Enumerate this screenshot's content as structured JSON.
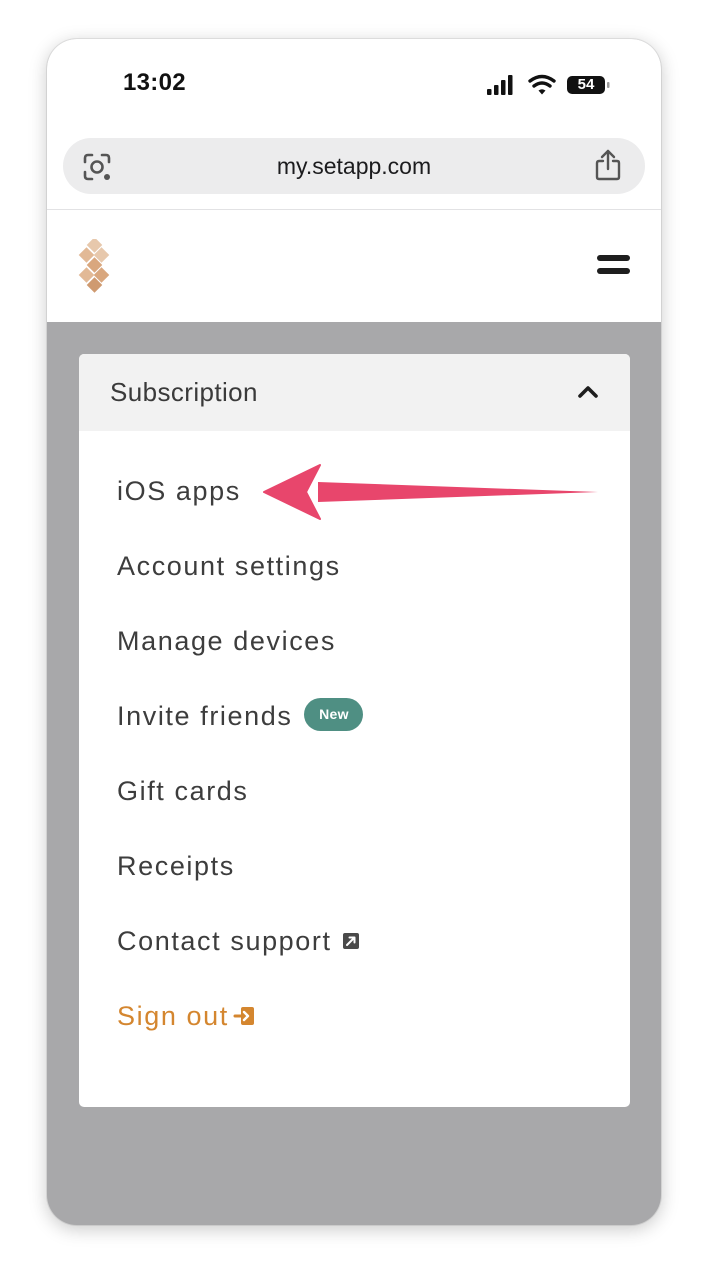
{
  "status_bar": {
    "time": "13:02",
    "battery": "54"
  },
  "browser": {
    "url": "my.setapp.com"
  },
  "menu": {
    "section_title": "Subscription",
    "items": [
      {
        "label": "iOS apps"
      },
      {
        "label": "Account settings"
      },
      {
        "label": "Manage devices"
      },
      {
        "label": "Invite friends",
        "badge": "New"
      },
      {
        "label": "Gift cards"
      },
      {
        "label": "Receipts"
      },
      {
        "label": "Contact support",
        "icon": "external-link-icon"
      },
      {
        "label": "Sign out",
        "icon": "sign-out-icon"
      }
    ]
  },
  "colors": {
    "accent_orange": "#d4862f",
    "badge_teal": "#4f8f83",
    "annotation_arrow": "#e8466c",
    "backdrop_gray": "#a8a8aa"
  }
}
